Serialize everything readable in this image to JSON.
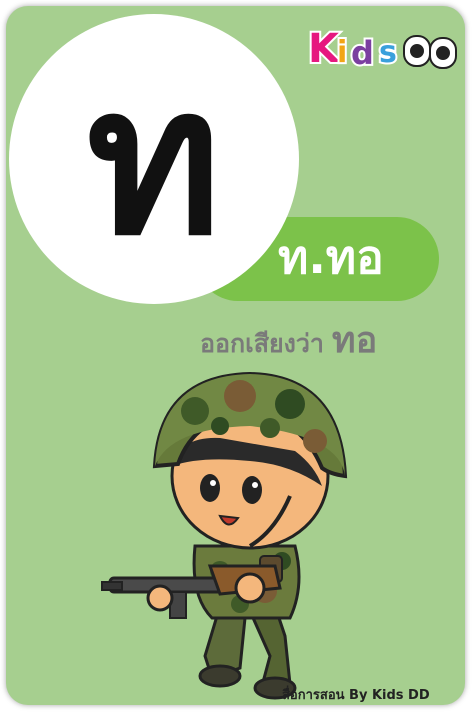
{
  "card": {
    "big_letter": "ท",
    "name": "ท.ทอ",
    "sound_prefix": "ออกเสียงว่า",
    "sound_word": "ทอ",
    "footer": "สื่อการสอน By Kids DD",
    "logo_text": "Kids DD",
    "illustration": "soldier-illustration"
  },
  "colors": {
    "card_background": "#a6cf8f",
    "pill": "#7cc24a",
    "circle": "#ffffff",
    "letter": "#111111",
    "sound_text": "#7a7a7a"
  }
}
